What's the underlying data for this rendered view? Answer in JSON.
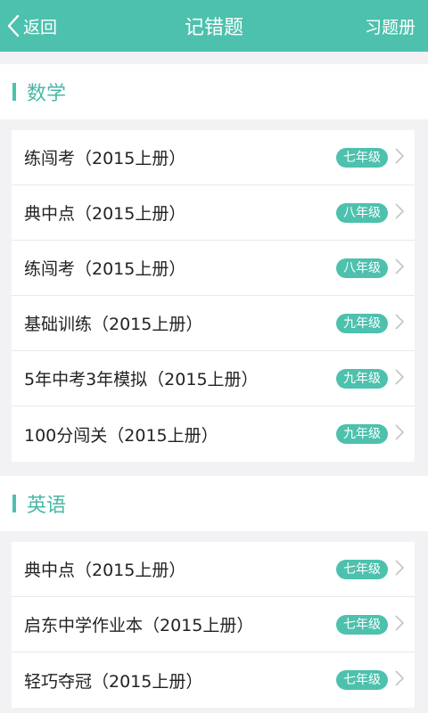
{
  "header": {
    "back_label": "返回",
    "title": "记错题",
    "right_label": "习题册"
  },
  "sections": [
    {
      "title": "数学",
      "items": [
        {
          "label": "练闯考（2015上册）",
          "grade": "七年级"
        },
        {
          "label": "典中点（2015上册）",
          "grade": "八年级"
        },
        {
          "label": "练闯考（2015上册）",
          "grade": "八年级"
        },
        {
          "label": "基础训练（2015上册）",
          "grade": "九年级"
        },
        {
          "label": "5年中考3年模拟（2015上册）",
          "grade": "九年级"
        },
        {
          "label": "100分闯关（2015上册）",
          "grade": "九年级"
        }
      ]
    },
    {
      "title": "英语",
      "items": [
        {
          "label": "典中点（2015上册）",
          "grade": "七年级"
        },
        {
          "label": "启东中学作业本（2015上册）",
          "grade": "七年级"
        },
        {
          "label": "轻巧夺冠（2015上册）",
          "grade": "七年级"
        }
      ]
    }
  ],
  "colors": {
    "accent": "#4dc1ad"
  },
  "icons": {
    "back": "chevron-left-icon",
    "row": "chevron-right-icon"
  }
}
